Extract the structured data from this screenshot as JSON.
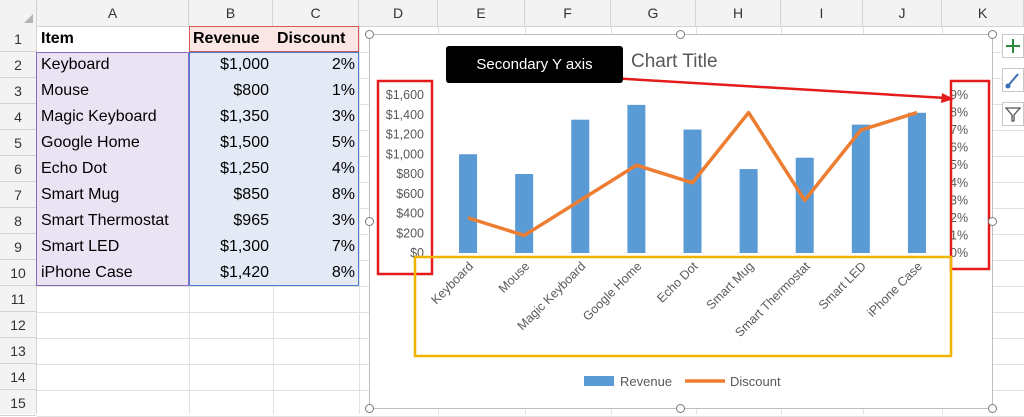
{
  "columns": [
    "A",
    "B",
    "C",
    "D",
    "E",
    "F",
    "G",
    "H",
    "I",
    "J",
    "K"
  ],
  "rows": [
    "1",
    "2",
    "3",
    "4",
    "5",
    "6",
    "7",
    "8",
    "9",
    "10",
    "11",
    "12",
    "13",
    "14",
    "15"
  ],
  "table": {
    "headers": [
      "Item",
      "Revenue",
      "Discount"
    ],
    "rows": [
      [
        "Keyboard",
        "$1,000",
        "2%"
      ],
      [
        "Mouse",
        "$800",
        "1%"
      ],
      [
        "Magic Keyboard",
        "$1,350",
        "3%"
      ],
      [
        "Google Home",
        "$1,500",
        "5%"
      ],
      [
        "Echo Dot",
        "$1,250",
        "4%"
      ],
      [
        "Smart Mug",
        "$850",
        "8%"
      ],
      [
        "Smart Thermostat",
        "$965",
        "3%"
      ],
      [
        "Smart LED",
        "$1,300",
        "7%"
      ],
      [
        "iPhone Case",
        "$1,420",
        "8%"
      ]
    ]
  },
  "callout": {
    "text": "Secondary Y axis"
  },
  "colors": {
    "bar": "#5b9bd5",
    "line": "#ed7d31",
    "red_box": "#e31b1b",
    "yellow_box": "#f0b400",
    "callout_bg": "#000000",
    "text_axis": "#595959",
    "title": "#595959"
  },
  "chart_data": {
    "type": "bar",
    "title": "Chart Title",
    "categories": [
      "Keyboard",
      "Mouse",
      "Magic Keyboard",
      "Google Home",
      "Echo Dot",
      "Smart Mug",
      "Smart Thermostat",
      "Smart LED",
      "iPhone Case"
    ],
    "series": [
      {
        "name": "Revenue",
        "type": "bar",
        "axis": "primary",
        "values": [
          1000,
          800,
          1350,
          1500,
          1250,
          850,
          965,
          1300,
          1420
        ]
      },
      {
        "name": "Discount",
        "type": "line",
        "axis": "secondary",
        "values": [
          2,
          1,
          3,
          5,
          4,
          8,
          3,
          7,
          8
        ]
      }
    ],
    "y_primary": {
      "ylim": [
        0,
        1600
      ],
      "ticks": [
        "$0",
        "$200",
        "$400",
        "$600",
        "$800",
        "$1,000",
        "$1,200",
        "$1,400",
        "$1,600"
      ]
    },
    "y_secondary": {
      "ylim": [
        0,
        9
      ],
      "ticks": [
        "0%",
        "1%",
        "2%",
        "3%",
        "4%",
        "5%",
        "6%",
        "7%",
        "8%",
        "9%"
      ]
    },
    "legend": "bottom",
    "grid": false
  },
  "side_buttons": [
    {
      "icon": "plus-icon"
    },
    {
      "icon": "brush-icon"
    },
    {
      "icon": "filter-icon"
    }
  ]
}
